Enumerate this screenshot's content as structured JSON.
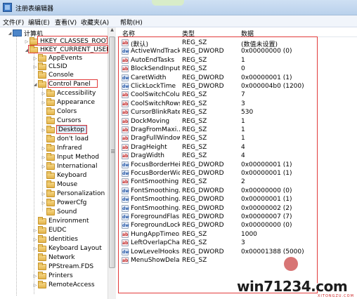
{
  "window": {
    "title": "注册表编辑器"
  },
  "menubar": {
    "items": [
      "文件(F)",
      "编辑(E)",
      "查看(V)",
      "收藏夹(A)",
      "帮助(H)"
    ]
  },
  "tree": {
    "nodes": [
      {
        "label": "计算机",
        "icon": "computer-icon"
      },
      {
        "label": "HKEY_CLASSES_ROOT",
        "icon": "folder-icon"
      },
      {
        "label": "HKEY_CURRENT_USER",
        "icon": "folder-icon"
      },
      {
        "label": "AppEvents",
        "icon": "folder-icon"
      },
      {
        "label": "CLSID",
        "icon": "folder-icon"
      },
      {
        "label": "Console",
        "icon": "folder-icon"
      },
      {
        "label": "Control Panel",
        "icon": "folder-icon"
      },
      {
        "label": "Accessibility",
        "icon": "folder-icon"
      },
      {
        "label": "Appearance",
        "icon": "folder-icon"
      },
      {
        "label": "Colors",
        "icon": "folder-icon"
      },
      {
        "label": "Cursors",
        "icon": "folder-icon"
      },
      {
        "label": "Desktop",
        "icon": "folder-icon"
      },
      {
        "label": "don't load",
        "icon": "folder-icon"
      },
      {
        "label": "Infrared",
        "icon": "folder-icon"
      },
      {
        "label": "Input Method",
        "icon": "folder-icon"
      },
      {
        "label": "International",
        "icon": "folder-icon"
      },
      {
        "label": "Keyboard",
        "icon": "folder-icon"
      },
      {
        "label": "Mouse",
        "icon": "folder-icon"
      },
      {
        "label": "Personalization",
        "icon": "folder-icon"
      },
      {
        "label": "PowerCfg",
        "icon": "folder-icon"
      },
      {
        "label": "Sound",
        "icon": "folder-icon"
      },
      {
        "label": "Environment",
        "icon": "folder-icon"
      },
      {
        "label": "EUDC",
        "icon": "folder-icon"
      },
      {
        "label": "Identities",
        "icon": "folder-icon"
      },
      {
        "label": "Keyboard Layout",
        "icon": "folder-icon"
      },
      {
        "label": "Network",
        "icon": "folder-icon"
      },
      {
        "label": "PPStream.FDS",
        "icon": "folder-icon"
      },
      {
        "label": "Printers",
        "icon": "folder-icon"
      },
      {
        "label": "RemoteAccess",
        "icon": "folder-icon"
      }
    ]
  },
  "list": {
    "headers": {
      "name": "名称",
      "type": "类型",
      "data": "数据"
    },
    "rows": [
      {
        "icon": "ab",
        "name": "(默认)",
        "type": "REG_SZ",
        "data": "(数值未设置)"
      },
      {
        "icon": "dw",
        "name": "ActiveWndTrack...",
        "type": "REG_DWORD",
        "data": "0x00000000 (0)"
      },
      {
        "icon": "ab",
        "name": "AutoEndTasks",
        "type": "REG_SZ",
        "data": "1"
      },
      {
        "icon": "ab",
        "name": "BlockSendInput...",
        "type": "REG_SZ",
        "data": "0"
      },
      {
        "icon": "dw",
        "name": "CaretWidth",
        "type": "REG_DWORD",
        "data": "0x00000001 (1)"
      },
      {
        "icon": "dw",
        "name": "ClickLockTime",
        "type": "REG_DWORD",
        "data": "0x000004b0 (1200)"
      },
      {
        "icon": "ab",
        "name": "CoolSwitchColu...",
        "type": "REG_SZ",
        "data": "7"
      },
      {
        "icon": "ab",
        "name": "CoolSwitchRows",
        "type": "REG_SZ",
        "data": "3"
      },
      {
        "icon": "ab",
        "name": "CursorBlinkRate",
        "type": "REG_SZ",
        "data": "530"
      },
      {
        "icon": "ab",
        "name": "DockMoving",
        "type": "REG_SZ",
        "data": "1"
      },
      {
        "icon": "ab",
        "name": "DragFromMaxi...",
        "type": "REG_SZ",
        "data": "1"
      },
      {
        "icon": "ab",
        "name": "DragFullWindows",
        "type": "REG_SZ",
        "data": "1"
      },
      {
        "icon": "ab",
        "name": "DragHeight",
        "type": "REG_SZ",
        "data": "4"
      },
      {
        "icon": "ab",
        "name": "DragWidth",
        "type": "REG_SZ",
        "data": "4"
      },
      {
        "icon": "dw",
        "name": "FocusBorderHei...",
        "type": "REG_DWORD",
        "data": "0x00000001 (1)"
      },
      {
        "icon": "dw",
        "name": "FocusBorderWid...",
        "type": "REG_DWORD",
        "data": "0x00000001 (1)"
      },
      {
        "icon": "ab",
        "name": "FontSmoothing",
        "type": "REG_SZ",
        "data": "2"
      },
      {
        "icon": "dw",
        "name": "FontSmoothing...",
        "type": "REG_DWORD",
        "data": "0x00000000 (0)"
      },
      {
        "icon": "dw",
        "name": "FontSmoothing...",
        "type": "REG_DWORD",
        "data": "0x00000001 (1)"
      },
      {
        "icon": "dw",
        "name": "FontSmoothing...",
        "type": "REG_DWORD",
        "data": "0x00000002 (2)"
      },
      {
        "icon": "dw",
        "name": "ForegroundFlas...",
        "type": "REG_DWORD",
        "data": "0x00000007 (7)"
      },
      {
        "icon": "dw",
        "name": "ForegroundLock...",
        "type": "REG_DWORD",
        "data": "0x00000000 (0)"
      },
      {
        "icon": "ab",
        "name": "HungAppTimeo...",
        "type": "REG_SZ",
        "data": "1000"
      },
      {
        "icon": "ab",
        "name": "LeftOverlapChars",
        "type": "REG_SZ",
        "data": "3"
      },
      {
        "icon": "dw",
        "name": "LowLevelHooks...",
        "type": "REG_DWORD",
        "data": "0x00001388 (5000)"
      },
      {
        "icon": "ab",
        "name": "MenuShowDelay",
        "type": "REG_SZ",
        "data": ""
      }
    ]
  },
  "watermark": {
    "site": "win71234.com",
    "sub": "XITONGZU.COM"
  }
}
